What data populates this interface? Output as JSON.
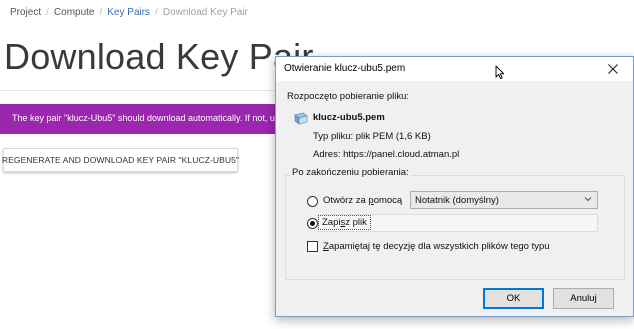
{
  "breadcrumb": {
    "items": [
      "Project",
      "Compute",
      "Key Pairs",
      "Download Key Pair"
    ],
    "separator": "/"
  },
  "page": {
    "title": "Download Key Pair",
    "alert_text": "The key pair \"klucz-Ubu5\" should download automatically. If not, use t",
    "regenerate_label": "REGENERATE AND DOWNLOAD KEY PAIR \"KLUCZ-UBU5\""
  },
  "dialog": {
    "title": "Otwieranie klucz-ubu5.pem",
    "intro": "Rozpoczęto pobieranie pliku:",
    "file_name": "klucz-ubu5.pem",
    "file_type": "Typ pliku:  plik PEM (1,6 KB)",
    "address": "Adres:  https://panel.cloud.atman.pl",
    "group_label": "Po zakończeniu pobierania:",
    "open_with_pre": "Otwórz za ",
    "open_with_u": "p",
    "open_with_post": "omocą",
    "open_with_app": "Notatnik (domyślny)",
    "save_pre": "Zapi",
    "save_u": "s",
    "save_post": "z plik",
    "remember_pre": "",
    "remember_u": "Z",
    "remember_post": "apamiętaj tę decyzję dla wszystkich plików tego typu",
    "ok_label": "OK",
    "cancel_label": "Anuluj",
    "selected_option": "save",
    "remember_checked": false
  },
  "icons": {
    "close": "close-icon",
    "cursor": "mouse-cursor-icon",
    "file": "file-icon",
    "dropdown": "chevron-down-icon"
  },
  "colors": {
    "alert_bg": "#9b27af",
    "link": "#3a6fb0",
    "dialog_border": "#7a9cc7",
    "ok_focus": "#0078d7"
  }
}
